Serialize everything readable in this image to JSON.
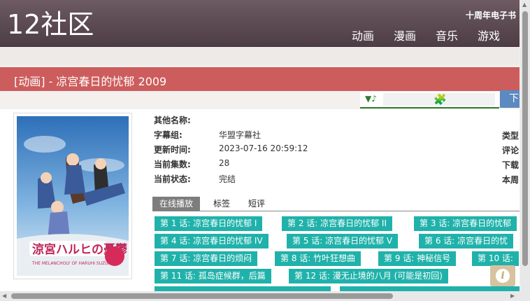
{
  "header": {
    "logo": "12社区",
    "anniversary": "十周年电子书",
    "nav": [
      "动画",
      "漫画",
      "音乐",
      "游戏"
    ]
  },
  "title_bar": {
    "title": "[动画] - 凉宫春日的忧郁 2009"
  },
  "player": {
    "note_icon": "▼♪",
    "download_label": "下载"
  },
  "poster": {
    "alt_title": "涼宮ハルヒの憂鬱",
    "subtitle": "THE MELANCHOLY OF HARUHI SUZUMIYA"
  },
  "info": {
    "other_names_label": "其他名称:",
    "fansub_label": "字幕组:",
    "fansub_value": "华盟字幕社",
    "updated_label": "更新时间:",
    "updated_value": "2023-07-16 20:59:12",
    "episodes_label": "当前集数:",
    "episodes_value": "28",
    "status_label": "当前状态:",
    "status_value": "完结",
    "right_labels": [
      "类型",
      "评论",
      "下载",
      "本周"
    ]
  },
  "tabs": [
    "在线播放",
    "标签",
    "短评"
  ],
  "episodes": [
    "第 1 话: 凉宫春日的忧郁 I",
    "第 2 话: 凉宫春日的忧郁 II",
    "第 3 话: 凉宫春日的忧郁",
    "第 4 话: 凉宫春日的忧郁 IV",
    "第 5 话: 凉宫春日的忧郁 V",
    "第 6 话: 凉宫春日的忧",
    "第 7 话: 凉宫春日的烦闷",
    "第 8 话: 竹叶狂想曲",
    "第 9 话: 神秘信号",
    "第 10 话:",
    "第 11 话: 孤岛症候群，后篇",
    "第 12 话: 漫无止境的八月 (可能是初回)"
  ]
}
